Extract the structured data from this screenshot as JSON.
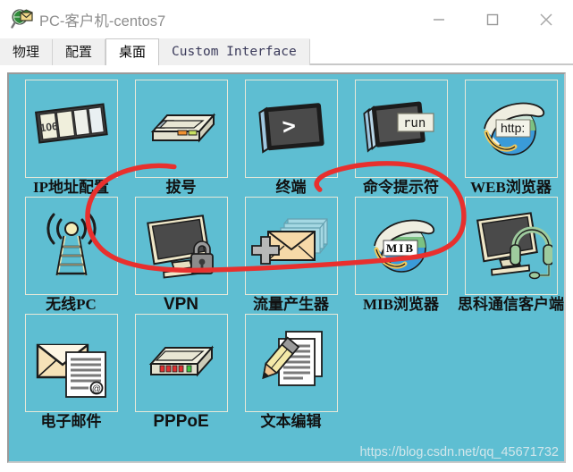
{
  "window": {
    "title": "PC-客户机-centos7",
    "app_icon": "packet-tracer-magnifier-icon",
    "controls": {
      "minimize": "−",
      "maximize": "□",
      "close": "✕"
    }
  },
  "tabs": [
    {
      "label": "物理",
      "active": false,
      "latin": false
    },
    {
      "label": "配置",
      "active": false,
      "latin": false
    },
    {
      "label": "桌面",
      "active": true,
      "latin": false
    },
    {
      "label": "Custom Interface",
      "active": false,
      "latin": true
    }
  ],
  "desktop": {
    "background_color": "#5ebed2",
    "icons": [
      {
        "label": "IP地址配置",
        "icon": "ip-configuration-icon",
        "latin": false
      },
      {
        "label": "拔号",
        "icon": "dial-up-modem-icon",
        "latin": false
      },
      {
        "label": "终端",
        "icon": "terminal-icon",
        "latin": false
      },
      {
        "label": "命令提示符",
        "icon": "command-prompt-run-icon",
        "latin": false
      },
      {
        "label": "WEB浏览器",
        "icon": "web-browser-globe-icon",
        "latin": false
      },
      {
        "label": "无线PC",
        "icon": "wireless-antenna-icon",
        "latin": false
      },
      {
        "label": "VPN",
        "icon": "vpn-monitor-lock-icon",
        "latin": true
      },
      {
        "label": "流量产生器",
        "icon": "traffic-generator-envelopes-icon",
        "latin": false
      },
      {
        "label": "MIB浏览器",
        "icon": "mib-browser-globe-icon",
        "latin": false
      },
      {
        "label": "思科通信客户端",
        "icon": "cisco-communicator-headset-icon",
        "latin": false
      },
      {
        "label": "电子邮件",
        "icon": "email-envelope-icon",
        "latin": false
      },
      {
        "label": "PPPoE",
        "icon": "pppoe-switch-icon",
        "latin": true
      },
      {
        "label": "文本编辑",
        "icon": "text-editor-pencil-icon",
        "latin": false
      }
    ],
    "icon_badges": {
      "ip_config_value": "106",
      "terminal_prompt": ">",
      "command_prompt_run": "run",
      "web_browser_http": "http:",
      "mib_browser_label": "MIB"
    },
    "annotation": {
      "type": "hand-drawn-red-circle",
      "color": "#e8302e",
      "encircles": "命令提示符"
    },
    "watermark": "https://blog.csdn.net/qq_45671732"
  }
}
